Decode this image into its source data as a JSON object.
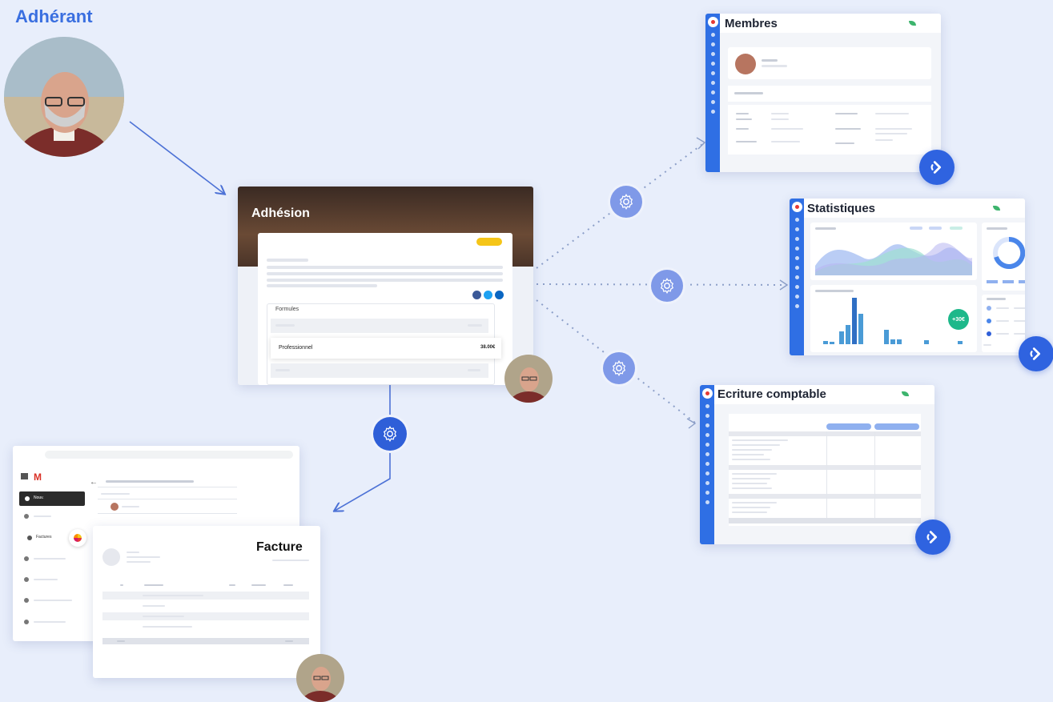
{
  "adherent": {
    "title": "Adhérant"
  },
  "adhesion": {
    "title": "Adhésion",
    "badge": "",
    "formules_label": "Formules",
    "selected_option": "Professionnel",
    "selected_price": "38.00€"
  },
  "membres": {
    "title": "Membres"
  },
  "statistiques": {
    "title": "Statistiques",
    "kpi": "+30€"
  },
  "ecriture": {
    "title": "Ecriture comptable"
  },
  "facture": {
    "title": "Facture"
  },
  "gmail": {
    "compose_label": "Nouv.",
    "factures_label": "Factures"
  },
  "icons": {
    "gear": "gear-icon",
    "app_logo": "refresh-logo-icon",
    "gmail": "gmail-logo-icon",
    "social": [
      "facebook-icon",
      "twitter-icon",
      "linkedin-icon"
    ]
  },
  "colors": {
    "primary": "#2f63e0",
    "background": "#e8eefb",
    "accent_yellow": "#f5c518",
    "kpi_green": "#1db88a"
  }
}
